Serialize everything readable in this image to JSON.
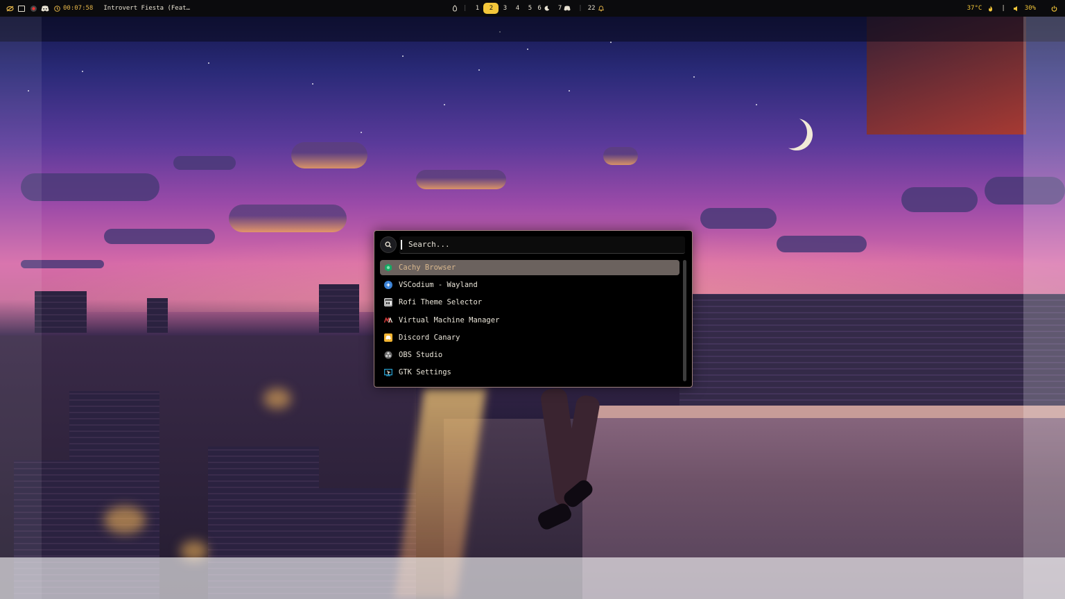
{
  "topbar": {
    "left": {
      "timer": "00:07:58",
      "now_playing": "Introvert Fiesta (Feat…",
      "icons": [
        "eye-slash-icon",
        "window-icon",
        "record-icon",
        "discord-icon",
        "clock-icon"
      ]
    },
    "workspaces": [
      {
        "label": "1",
        "active": false
      },
      {
        "label": "2",
        "active": true
      },
      {
        "label": "3",
        "active": false
      },
      {
        "label": "4",
        "active": false
      },
      {
        "label": "5",
        "active": false
      },
      {
        "label": "6",
        "active": false
      },
      {
        "label": "7",
        "active": false
      }
    ],
    "notifications": "22",
    "right": {
      "temperature": "37°C",
      "separator": "|",
      "volume": "30%"
    }
  },
  "launcher": {
    "search_placeholder": "Search...",
    "items": [
      {
        "label": "Cachy Browser",
        "icon": "cachy-browser-icon",
        "color": "#1aa864",
        "selected": true
      },
      {
        "label": "VSCodium - Wayland",
        "icon": "vscodium-icon",
        "color": "#3b82d6",
        "selected": false
      },
      {
        "label": "Rofi Theme Selector",
        "icon": "rofi-icon",
        "color": "#cfcfcf",
        "selected": false
      },
      {
        "label": "Virtual Machine Manager",
        "icon": "virt-manager-icon",
        "color": "#d23a3a",
        "selected": false
      },
      {
        "label": "Discord Canary",
        "icon": "discord-canary-icon",
        "color": "#f2b431",
        "selected": false
      },
      {
        "label": "OBS Studio",
        "icon": "obs-icon",
        "color": "#8a8a8a",
        "selected": false
      },
      {
        "label": "GTK Settings",
        "icon": "gtk-settings-icon",
        "color": "#2aa6d8",
        "selected": false
      }
    ]
  },
  "colors": {
    "accent": "#f4c73a",
    "selection": "#6b625e",
    "launcher_border": "#9c7f7c"
  }
}
